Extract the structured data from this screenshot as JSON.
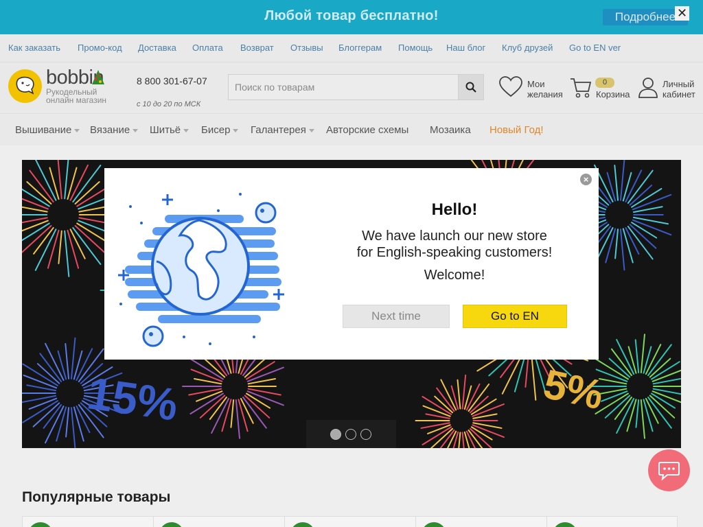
{
  "promo": {
    "text": "Любой товар бесплатно!",
    "more_label": "Подробнее",
    "close_label": "✕"
  },
  "info_links": [
    "Как заказать",
    "Промо-код",
    "Доставка",
    "Оплата",
    "Возврат",
    "Отзывы",
    "Блоггерам",
    "Помощь",
    "Наш блог",
    "Клуб друзей",
    "Go to EN ver"
  ],
  "header": {
    "logo_word": "bobbin",
    "logo_sub_1": "Рукодельный",
    "logo_sub_2": "онлайн магазин",
    "phone": "8 800 301-67-07",
    "hours": "с 10 до 20 по МСК",
    "search_placeholder": "Поиск по товарам",
    "wishlist_1": "Мои",
    "wishlist_2": "желания",
    "cart_count": "0",
    "cart_label": "Корзина",
    "account_1": "Личный",
    "account_2": "кабинет"
  },
  "nav": [
    {
      "label": "Вышивание",
      "dropdown": true
    },
    {
      "label": "Вязание",
      "dropdown": true
    },
    {
      "label": "Шитьё",
      "dropdown": true
    },
    {
      "label": "Бисер",
      "dropdown": true
    },
    {
      "label": "Галантерея",
      "dropdown": true
    },
    {
      "label": "Авторские схемы",
      "dropdown": false
    },
    {
      "label": "Мозаика",
      "dropdown": false
    },
    {
      "label": "Новый Год!",
      "dropdown": false,
      "accent": "#e0862a"
    }
  ],
  "slider": {
    "discount_left": "15%",
    "discount_right": "5%",
    "dots": 3,
    "active_dot": 0
  },
  "popular_title": "Популярные товары",
  "modal": {
    "close_label": "×",
    "title": "Hello!",
    "text_1": "We have launch our new store",
    "text_2": "for English-speaking customers!",
    "welcome": "Welcome!",
    "next_label": "Next time",
    "go_label": "Go to EN"
  },
  "colors": {
    "promo_bg": "#19a9c6",
    "link": "#4a7fa8",
    "accent_orange": "#e0862a",
    "go_button": "#f7d80f",
    "chat": "#f26b78",
    "logo_yellow": "#f2c200"
  }
}
